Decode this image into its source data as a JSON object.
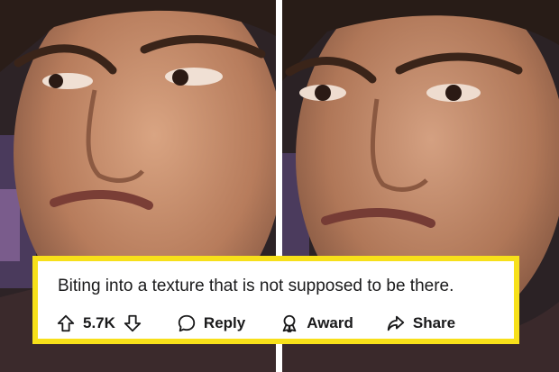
{
  "comment": {
    "text": "Biting into a texture that is not supposed to be there.",
    "votes": "5.7K",
    "reply_label": "Reply",
    "award_label": "Award",
    "share_label": "Share",
    "icons": [
      "upvote-arrow-icon",
      "downvote-arrow-icon",
      "speech-bubble-icon",
      "award-ribbon-icon",
      "share-arrow-icon"
    ]
  },
  "colors": {
    "highlight_border": "#f7e01a",
    "text": "#1a1a1b"
  }
}
